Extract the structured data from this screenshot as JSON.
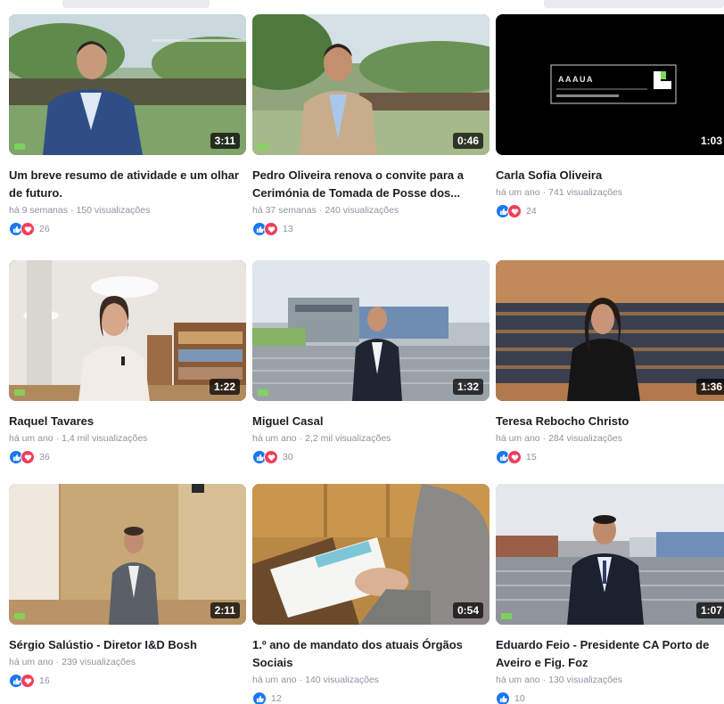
{
  "videos": [
    {
      "title": "Um breve resumo de atividade e um olhar de futuro.",
      "age": "há 9 semanas",
      "views": "150 visualizações",
      "duration": "3:11",
      "reaction_count": "26",
      "reactions": [
        "like",
        "love"
      ]
    },
    {
      "title": "Pedro Oliveira renova o convite para a Cerimónia de Tomada de Posse dos...",
      "age": "há 37 semanas",
      "views": "240 visualizações",
      "duration": "0:46",
      "reaction_count": "13",
      "reactions": [
        "like",
        "love"
      ]
    },
    {
      "title": "Carla Sofia Oliveira",
      "age": "há um ano",
      "views": "741 visualizações",
      "duration": "1:03",
      "reaction_count": "24",
      "reactions": [
        "like",
        "love"
      ],
      "overlay_text": "AAAUA"
    },
    {
      "title": "Raquel Tavares",
      "age": "há um ano",
      "views": "1,4 mil visualizações",
      "duration": "1:22",
      "reaction_count": "36",
      "reactions": [
        "like",
        "love"
      ]
    },
    {
      "title": "Miguel Casal",
      "age": "há um ano",
      "views": "2,2 mil visualizações",
      "duration": "1:32",
      "reaction_count": "30",
      "reactions": [
        "like",
        "love"
      ]
    },
    {
      "title": "Teresa Rebocho Christo",
      "age": "há um ano",
      "views": "284 visualizações",
      "duration": "1:36",
      "reaction_count": "15",
      "reactions": [
        "like",
        "love"
      ]
    },
    {
      "title": "Sérgio Salústio - Diretor I&D Bosh",
      "age": "há um ano",
      "views": "239 visualizações",
      "duration": "2:11",
      "reaction_count": "16",
      "reactions": [
        "like",
        "love"
      ]
    },
    {
      "title": "1.º ano de mandato dos atuais Órgãos Sociais",
      "age": "há um ano",
      "views": "140 visualizações",
      "duration": "0:54",
      "reaction_count": "12",
      "reactions": [
        "like"
      ]
    },
    {
      "title": "Eduardo Feio - Presidente CA Porto de Aveiro e Fig. Foz",
      "age": "há um ano",
      "views": "130 visualizações",
      "duration": "1:07",
      "reaction_count": "10",
      "reactions": [
        "like"
      ]
    }
  ],
  "colors": {
    "like": "#1877f2",
    "love": "#f33e58",
    "meta": "#8d949e"
  }
}
